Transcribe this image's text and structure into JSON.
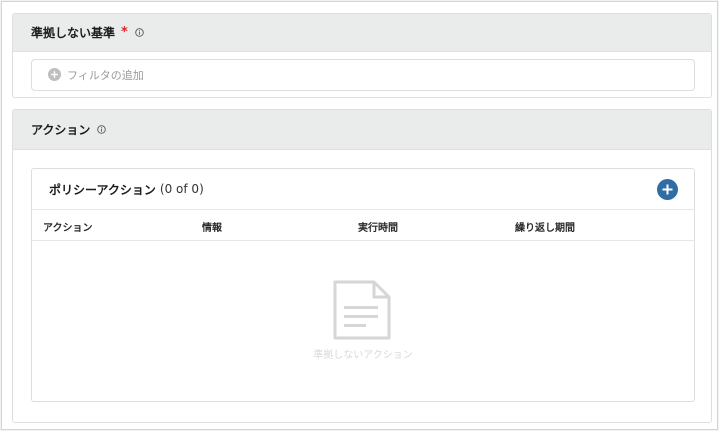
{
  "criteria": {
    "title": "準拠しない基準",
    "required_mark": "*",
    "info_icon": "info-circle-icon",
    "filter_add_label": "フィルタの追加",
    "filter_add_icon": "plus-circle-icon"
  },
  "actions": {
    "title": "アクション",
    "info_icon": "info-circle-icon",
    "policy": {
      "title": "ポリシーアクション",
      "count": "(0 of 0)",
      "add_icon": "plus-icon",
      "columns": [
        "アクション",
        "情報",
        "実行時間",
        "繰り返し期間"
      ],
      "empty_icon": "document-icon",
      "empty_text": "準拠しないアクション"
    }
  },
  "colors": {
    "accent": "#2f6da4",
    "header_bg": "#eaecec",
    "required": "#d9262e"
  }
}
